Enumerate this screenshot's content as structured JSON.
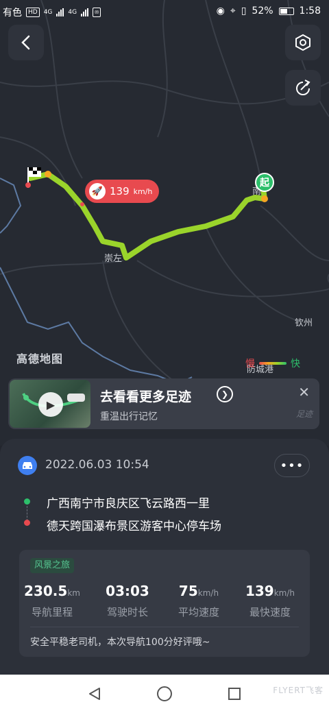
{
  "status_bar": {
    "left_text": "有色",
    "hd": "HD",
    "net1": "4G",
    "net2": "4G",
    "battery": "52%",
    "time": "1:58"
  },
  "map": {
    "places": [
      "崇左",
      "南",
      "钦州",
      "防城港"
    ],
    "logo": "高德地图",
    "start_label": "起",
    "max_speed_tip": {
      "value": "139",
      "unit": "km/h"
    },
    "legend": {
      "slow": "慢",
      "fast": "快"
    }
  },
  "promo": {
    "title": "去看看更多足迹",
    "subtitle": "重温出行记忆",
    "brand": "足迹"
  },
  "trip": {
    "datetime": "2022.06.03 10:54",
    "more": "•••",
    "start_address": "广西南宁市良庆区飞云路西一里",
    "end_address": "德天跨国瀑布景区游客中心停车场",
    "tag": "风景之旅",
    "stats": [
      {
        "value": "230.5",
        "unit": "km",
        "label": "导航里程"
      },
      {
        "value": "03:03",
        "unit": "",
        "label": "驾驶时长"
      },
      {
        "value": "75",
        "unit": "km/h",
        "label": "平均速度"
      },
      {
        "value": "139",
        "unit": "km/h",
        "label": "最快速度"
      }
    ],
    "comment": "安全平稳老司机，本次导航100分好评哦~"
  },
  "watermark": "FLYERT飞客",
  "colors": {
    "start": "#2dbf6b",
    "end": "#e84a4f",
    "route": "#9ad42b",
    "accent": "#3f7ff0"
  }
}
